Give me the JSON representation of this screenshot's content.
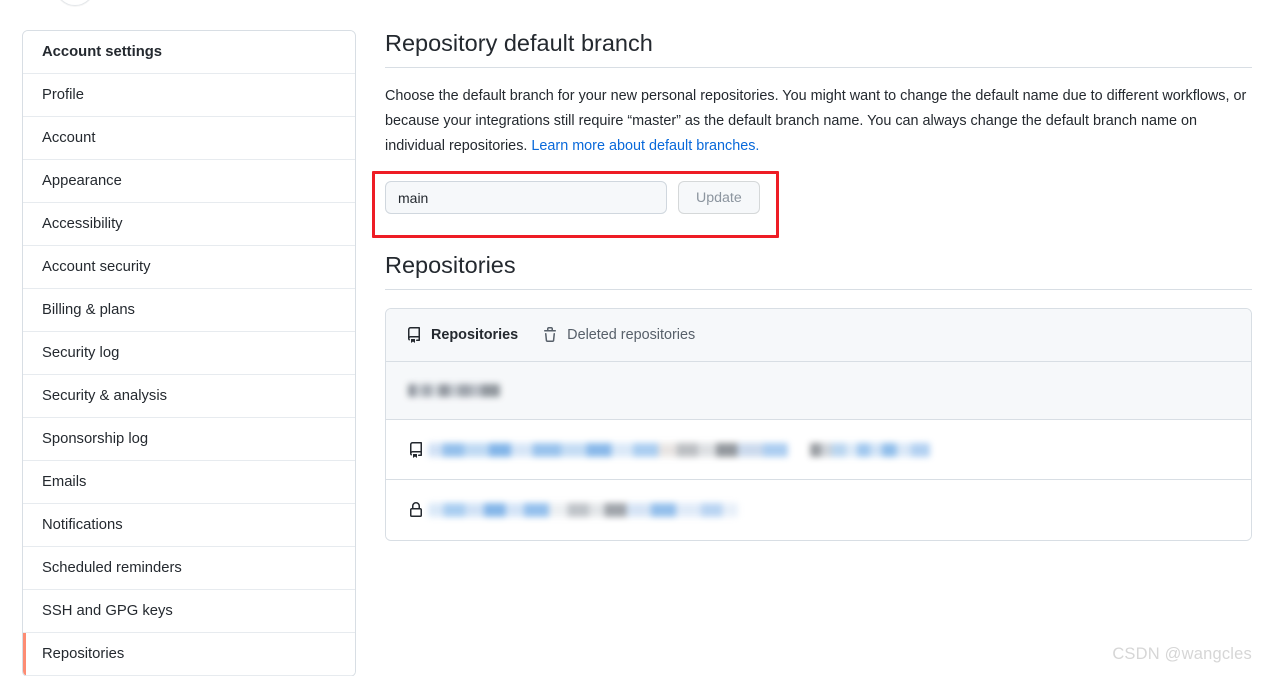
{
  "sidebar": {
    "header": "Account settings",
    "items": [
      {
        "label": "Profile",
        "active": false
      },
      {
        "label": "Account",
        "active": false
      },
      {
        "label": "Appearance",
        "active": false
      },
      {
        "label": "Accessibility",
        "active": false
      },
      {
        "label": "Account security",
        "active": false
      },
      {
        "label": "Billing & plans",
        "active": false
      },
      {
        "label": "Security log",
        "active": false
      },
      {
        "label": "Security & analysis",
        "active": false
      },
      {
        "label": "Sponsorship log",
        "active": false
      },
      {
        "label": "Emails",
        "active": false
      },
      {
        "label": "Notifications",
        "active": false
      },
      {
        "label": "Scheduled reminders",
        "active": false
      },
      {
        "label": "SSH and GPG keys",
        "active": false
      },
      {
        "label": "Repositories",
        "active": true
      }
    ]
  },
  "default_branch": {
    "title": "Repository default branch",
    "description_part1": "Choose the default branch for your new personal repositories. You might want to change the default name due to different workflows, or because your integrations still require “master” as the default branch name. You can always change the default branch name on individual repositories. ",
    "link_text": "Learn more about default branches.",
    "input_value": "main",
    "input_placeholder": "main",
    "update_label": "Update",
    "update_disabled": true,
    "annotation_color": "#ee1c25"
  },
  "repositories": {
    "title": "Repositories",
    "tabs": [
      {
        "label": "Repositories",
        "icon": "repo-icon",
        "selected": true
      },
      {
        "label": "Deleted repositories",
        "icon": "trash-icon",
        "selected": false
      }
    ],
    "rows": [
      {
        "type": "filter",
        "icon": "none",
        "redacted": true
      },
      {
        "type": "repository",
        "icon": "repo-icon",
        "redacted": true
      },
      {
        "type": "repository",
        "icon": "lock-icon",
        "redacted": true
      }
    ]
  },
  "watermark": "CSDN @wangcles",
  "colors": {
    "link": "#0969da",
    "active_marker": "#fd8c73",
    "panel_border": "#d8dee4",
    "panel_header_bg": "#f6f8fa",
    "text": "#24292f",
    "muted_text": "#57606a"
  }
}
